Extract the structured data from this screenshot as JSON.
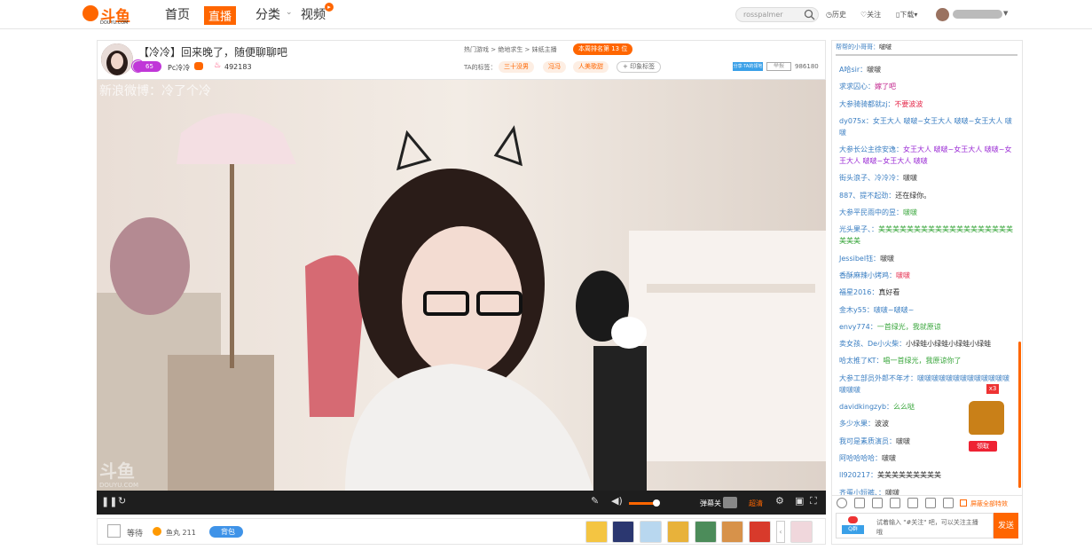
{
  "nav": {
    "logo_text": "斗鱼",
    "logo_sub": "DOUYU.COM",
    "home": "首页",
    "live": "直播",
    "category": "分类",
    "video": "视频",
    "search_value": "rosspalmer",
    "history": "历史",
    "follow": "关注",
    "download": "下载"
  },
  "room": {
    "title": "【冷冷】回来晚了，随便聊聊吧",
    "level": "65",
    "anchor_name": "Pc冷冷",
    "hot_value": "492183",
    "breadcrumb": "热门游戏 > 绝地求生 > 妹纸主播",
    "rank": "本周排名第 13 位",
    "tags_label": "TA的标签：",
    "tags": [
      "三十没男",
      "冯冯",
      "人美歌甜"
    ],
    "tag_add": "+ 印象标签",
    "share": "分享·TA的领地",
    "report": "举报",
    "room_id": "986180"
  },
  "video": {
    "watermark_weibo": "新浪微博：冷了个冷",
    "watermark_logo": "斗鱼",
    "watermark_logo_sub": "DOUYU.COM",
    "danmu_label": "弹幕关",
    "quality": "超清"
  },
  "below": {
    "wait_label": "等待",
    "fishball_label": "鱼丸 211",
    "backpack": "背包"
  },
  "chat": {
    "top_who": "帮帮的小哥哥：",
    "top_text": "啵啵",
    "messages": [
      {
        "who": "A哈sir：",
        "text": "啵啵",
        "color": "#333333"
      },
      {
        "who": "求求囚心：",
        "text": "嫁了吧",
        "color": "#c0208b"
      },
      {
        "who": "大参骑骑都就zj：",
        "text": "不要波波",
        "color": "#e5294b"
      },
      {
        "who": "dy075x：",
        "text": "女王大人 啵啵~女王大人 啵啵~女王大人 啵啵",
        "color": "#3a7ec2"
      },
      {
        "who": "大参长公主徐安逸：",
        "text": "女王大人 啵啵~女王大人 啵啵~女王大人 啵啵~女王大人 啵啵",
        "color": "#9a2bd4"
      },
      {
        "who": "街头浪子、冷冷冷：",
        "text": "啵啵",
        "color": "#333333"
      },
      {
        "who": "887、提不起劲：",
        "text": "还在绿你。",
        "color": "#333333"
      },
      {
        "who": "大参平民雨中的昱：",
        "text": "啵啵",
        "color": "#37a53a"
      },
      {
        "who": "光头果子、：",
        "text": "美美美美美美美美美美美美美美美美美美美美美美",
        "color": "#37a53a"
      },
      {
        "who": "Jessibel钰：",
        "text": "啵啵",
        "color": "#333333"
      },
      {
        "who": "香酥麻辣小烤鸡：",
        "text": "啵啵",
        "color": "#e5294b"
      },
      {
        "who": "福星2016：",
        "text": "真好看",
        "color": "#333333"
      },
      {
        "who": "金木y55：",
        "text": "啵啵~啵啵~",
        "color": "#3a7ec2"
      },
      {
        "who": "envy774：",
        "text": "一首绿光，我就原谅",
        "color": "#37a53a"
      },
      {
        "who": "卖女孩、De小火柴：",
        "text": "小绿蛙小绿蛙小绿蛙小绿蛙",
        "color": "#333333"
      },
      {
        "who": "哈太推了KT：",
        "text": "唱一首绿光，我原谅你了",
        "color": "#37a53a"
      },
      {
        "who": "大参工部员外郎不年才：",
        "text": "啵啵啵啵啵啵啵啵啵啵啵啵啵啵啵啵",
        "color": "#3a7ec2"
      },
      {
        "who": "davidkingzyb：",
        "text": "么么哒",
        "color": "#37a53a"
      },
      {
        "who": "多少水果：",
        "text": "波波",
        "color": "#333333"
      },
      {
        "who": "我可是素质演员：",
        "text": "啵啵",
        "color": "#333333"
      },
      {
        "who": "阿哈哈哈哈：",
        "text": "啵啵",
        "color": "#333333"
      },
      {
        "who": "ll920217：",
        "text": "美美美美美美美美美",
        "color": "#333333"
      },
      {
        "who": "齐蛋小短裤、：",
        "text": "啵啵",
        "color": "#333333"
      }
    ],
    "chest_count": "x3",
    "chest_claim": "领取",
    "hide_effects": "屏蔽全部特效",
    "qq_label": "Q群",
    "input_placeholder": "试着输入 \"#关注\" 吧，可以关注主播哦",
    "send": "发送"
  },
  "colors": {
    "accent": "#ff6600",
    "link": "#3a7ec2"
  },
  "icons": [
    "search-icon",
    "history-icon",
    "heart-icon",
    "phone-icon",
    "play-icon",
    "refresh-icon",
    "edit-icon",
    "volume-icon",
    "settings-icon",
    "fullscreen-icon"
  ]
}
